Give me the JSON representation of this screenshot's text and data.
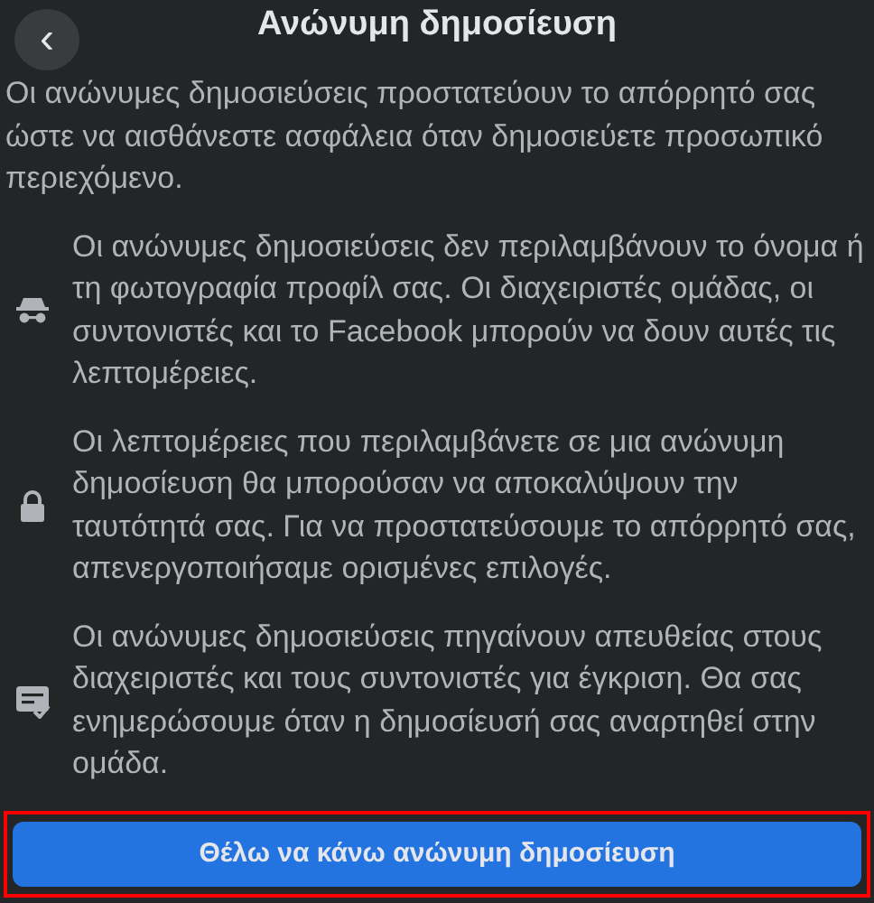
{
  "header": {
    "title": "Ανώνυμη δημοσίευση",
    "back_icon": "‹"
  },
  "intro": "Οι ανώνυμες δημοσιεύσεις προστατεύουν το απόρρητό σας ώστε να αισθάνεστε ασφάλεια όταν δημοσιεύετε προσωπικό περιεχόμενο.",
  "items": [
    {
      "kind": "incognito",
      "text": "Οι ανώνυμες δημοσιεύσεις δεν περιλαμβάνουν το όνομα ή τη φωτογραφία προφίλ σας. Οι διαχειριστές ομάδας, οι συντονιστές και το Facebook μπορούν να δουν αυτές τις λεπτομέρειες."
    },
    {
      "kind": "lock",
      "text": "Οι λεπτομέρειες που περιλαμβάνετε σε μια ανώνυμη δημοσίευση θα μπορούσαν να αποκαλύψουν την ταυτότητά σας. Για να προστατεύσουμε το απόρρητό σας, απενεργοποιήσαμε ορισμένες επιλογές."
    },
    {
      "kind": "review",
      "text": "Οι ανώνυμες δημοσιεύσεις πηγαίνουν απευθείας στους διαχειριστές και τους συντονιστές για έγκριση. Θα σας ενημερώσουμε όταν η δημοσίευσή σας αναρτηθεί στην ομάδα."
    }
  ],
  "button": {
    "label": "Θέλω να κάνω ανώνυμη δημοσίευση",
    "highlighted": true
  }
}
